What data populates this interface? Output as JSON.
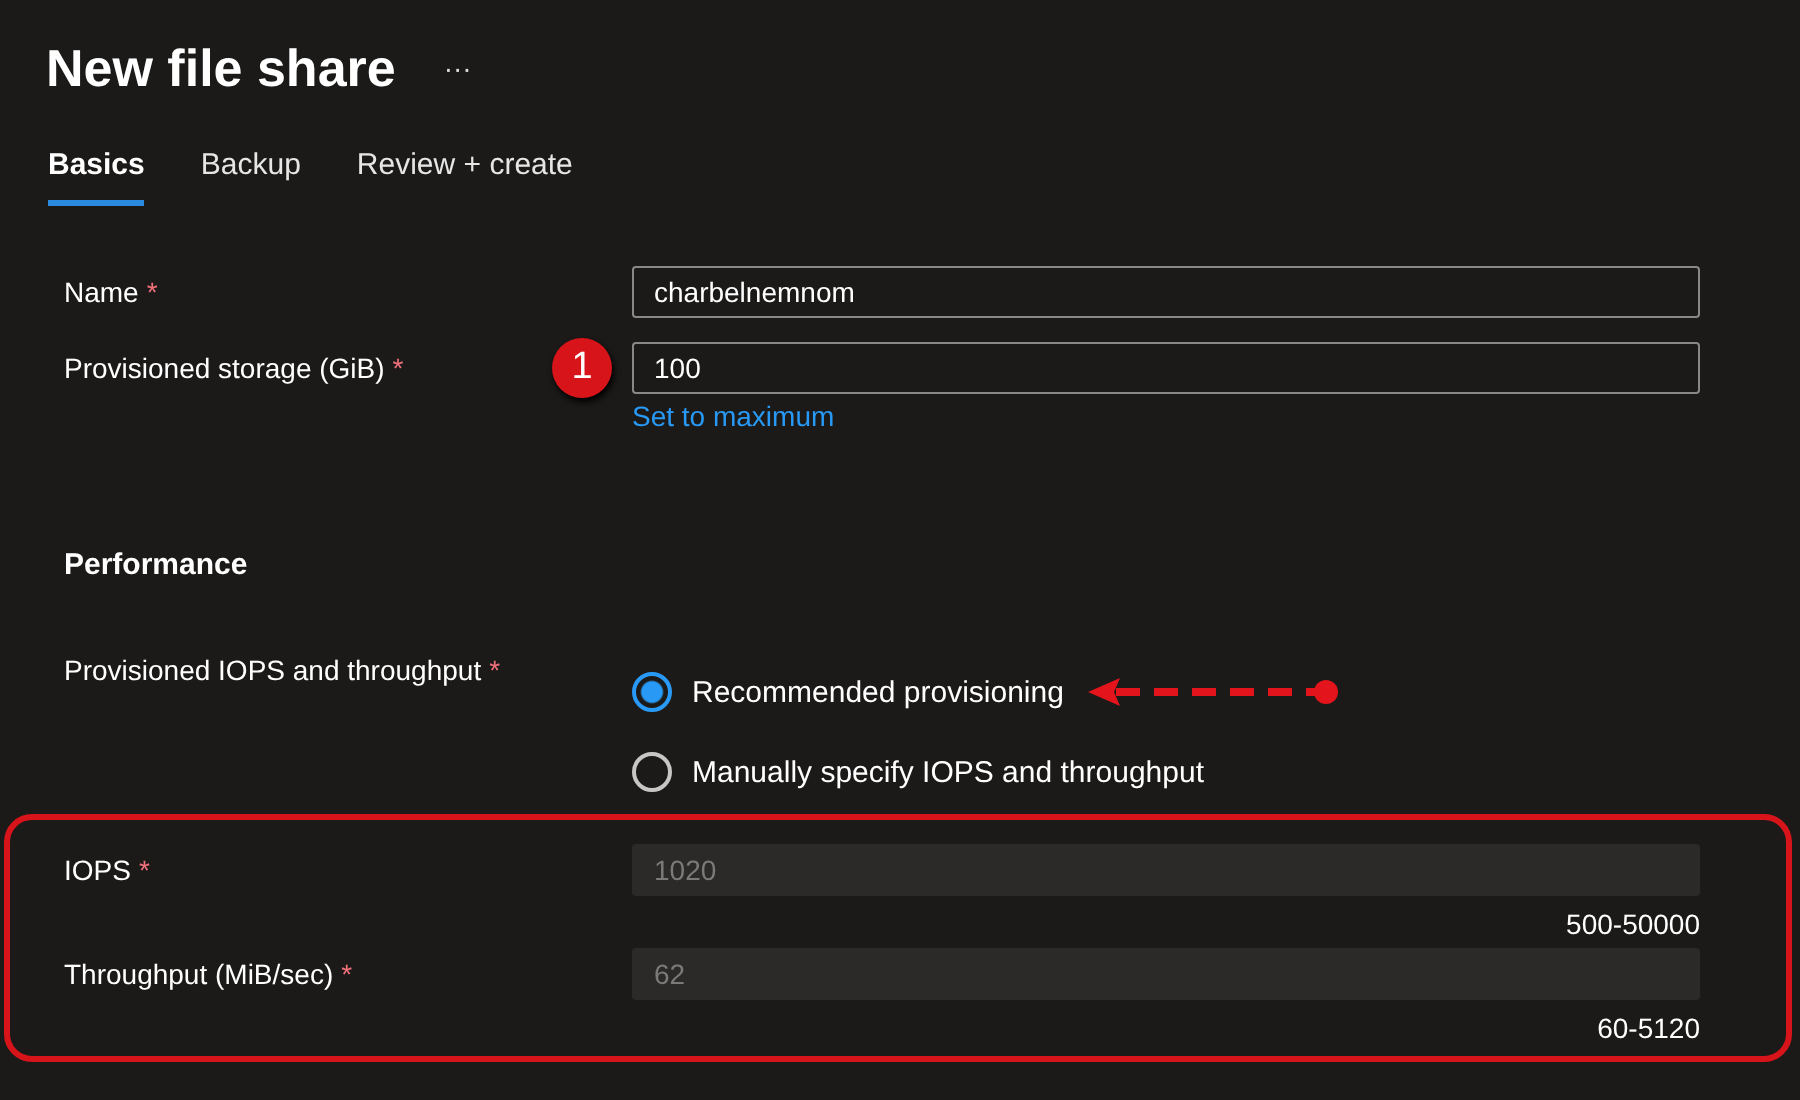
{
  "header": {
    "title": "New file share",
    "more": "···"
  },
  "tabs": [
    {
      "label": "Basics",
      "selected": true
    },
    {
      "label": "Backup",
      "selected": false
    },
    {
      "label": "Review + create",
      "selected": false
    }
  ],
  "fields": [
    {
      "label": "Name",
      "required_mark": "*",
      "value": "charbelnemnom",
      "disabled": false
    },
    {
      "label": "Provisioned storage (GiB)",
      "required_mark": "*",
      "value": "100",
      "disabled": false,
      "step": "1",
      "link": "Set to maximum"
    }
  ],
  "performance": {
    "heading": "Performance",
    "label": "Provisioned IOPS and throughput",
    "required_mark": "*",
    "options": [
      {
        "label": "Recommended provisioning",
        "selected": true,
        "arrow": true
      },
      {
        "label": "Manually specify IOPS and throughput",
        "selected": false,
        "arrow": false
      }
    ]
  },
  "highlighted_fields": [
    {
      "label": "IOPS",
      "required_mark": "*",
      "value": "1020",
      "disabled": true,
      "range": "500-50000"
    },
    {
      "label": "Throughput (MiB/sec)",
      "required_mark": "*",
      "value": "62",
      "disabled": true,
      "range": "60-5120"
    }
  ]
}
